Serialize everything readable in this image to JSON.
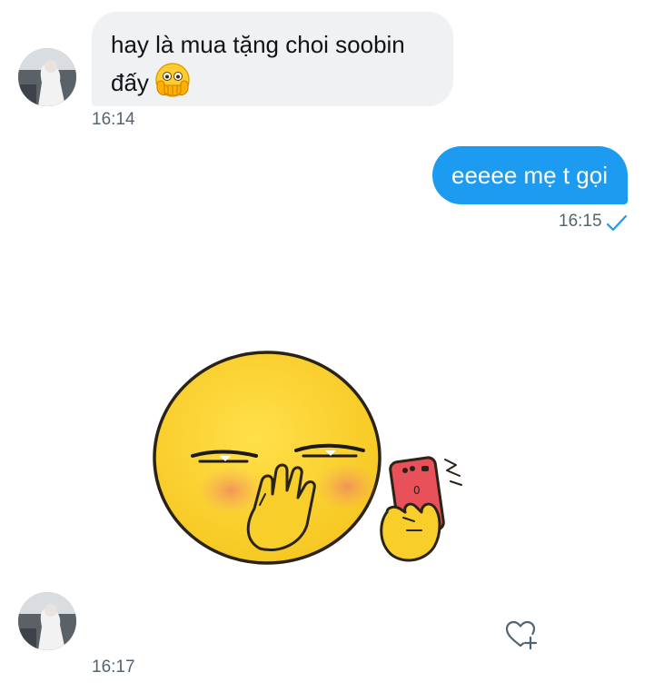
{
  "messages": [
    {
      "direction": "incoming",
      "text": "hay là mua tặng choi soobin đấy",
      "emoji": "face-with-open-eyes-and-hand-over-mouth-emoji",
      "time": "16:14"
    },
    {
      "direction": "outgoing",
      "text": "eeeee mẹ t gọi",
      "time": "16:15",
      "status": "read"
    },
    {
      "direction": "incoming",
      "type": "sticker",
      "sticker": "yellow-emoji-hiding-laugh-with-phone",
      "time": "16:17"
    }
  ],
  "actions": {
    "react_icon": "heart-plus-icon"
  },
  "colors": {
    "incoming_bubble": "#eff1f3",
    "outgoing_bubble": "#1d9bf0",
    "timestamp": "#536471",
    "text": "#0f1419"
  }
}
